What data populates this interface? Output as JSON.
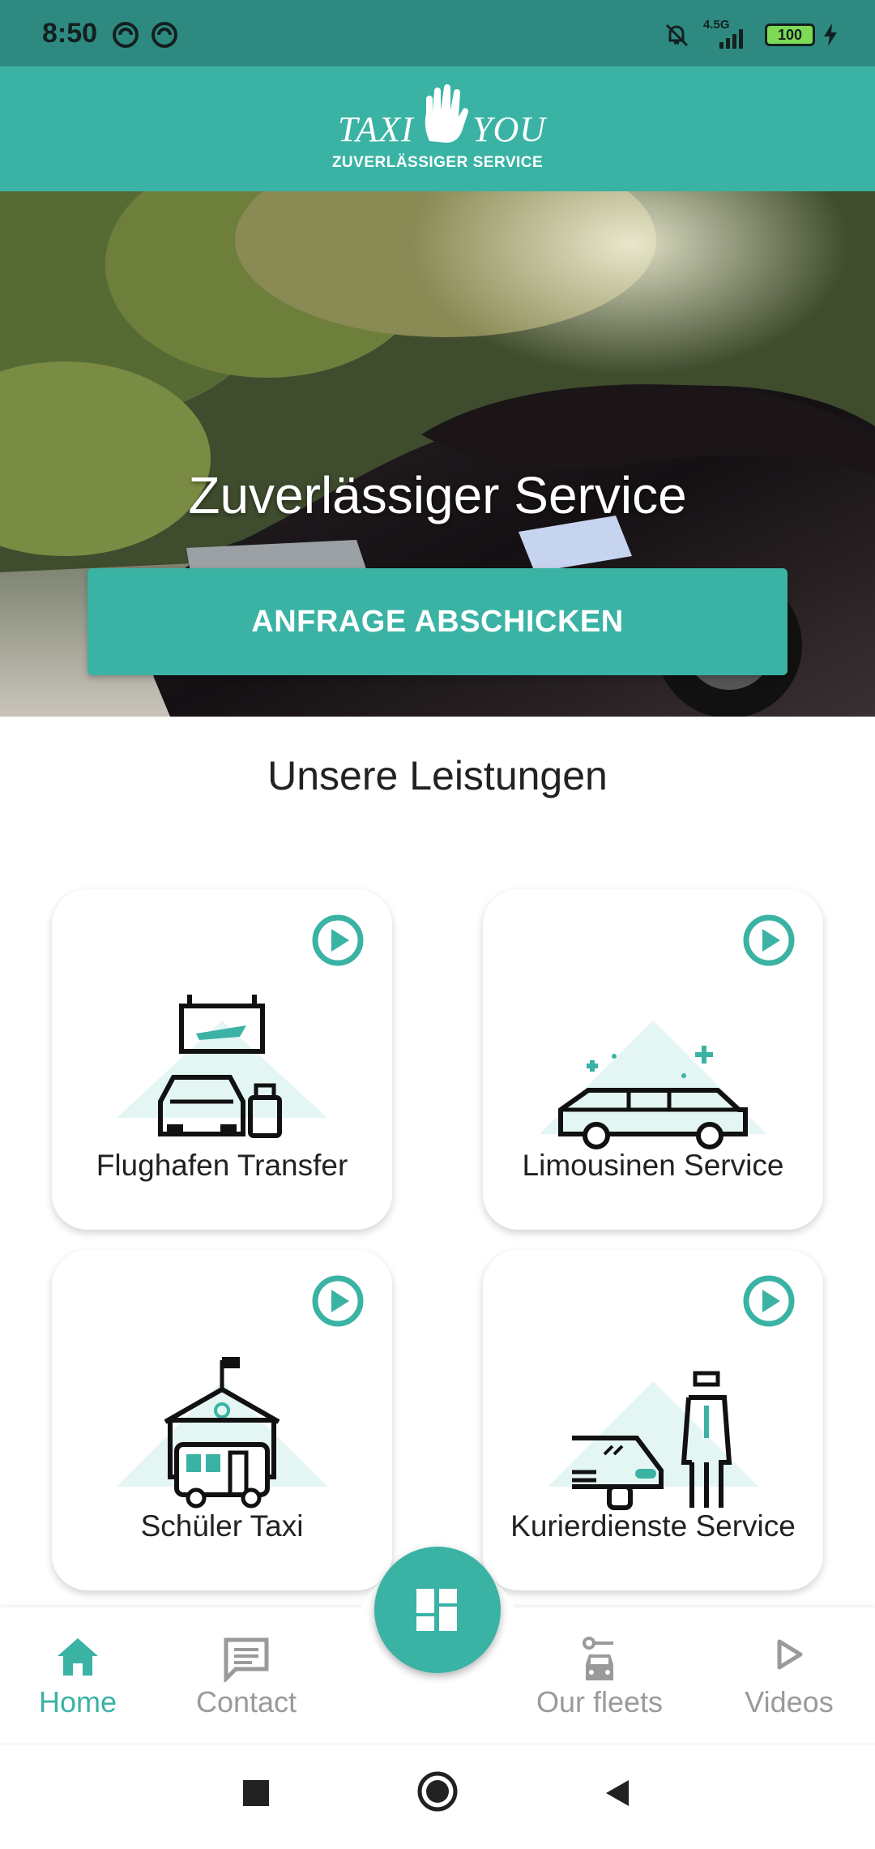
{
  "status_bar": {
    "time": "8:50",
    "network": "4.5G",
    "battery": "100"
  },
  "brand": {
    "left": "TAXI",
    "right": "YOU",
    "tagline": "ZUVERLÄSSIGER SERVICE"
  },
  "hero": {
    "title": "Zuverlässiger Service",
    "button_label": "ANFRAGE ABSCHICKEN"
  },
  "services": {
    "title": "Unsere Leistungen",
    "items": [
      {
        "label": "Flughafen Transfer",
        "icon": "airport-transfer-icon"
      },
      {
        "label": "Limousinen Service",
        "icon": "limousine-icon"
      },
      {
        "label": "Schüler Taxi",
        "icon": "school-bus-icon"
      },
      {
        "label": "Kurierdienste Service",
        "icon": "courier-icon"
      }
    ]
  },
  "bottom_nav": {
    "items": [
      {
        "label": "Home",
        "icon": "home-icon",
        "active": true
      },
      {
        "label": "Contact",
        "icon": "chat-icon",
        "active": false
      },
      {
        "label": "Our fleets",
        "icon": "car-key-icon",
        "active": false
      },
      {
        "label": "Videos",
        "icon": "play-outline-icon",
        "active": false
      }
    ],
    "fab_icon": "dashboard-icon"
  },
  "colors": {
    "primary": "#3ab3a4",
    "status_bar": "#2e8a80",
    "text": "#222222",
    "inactive": "#9a9a9a"
  }
}
